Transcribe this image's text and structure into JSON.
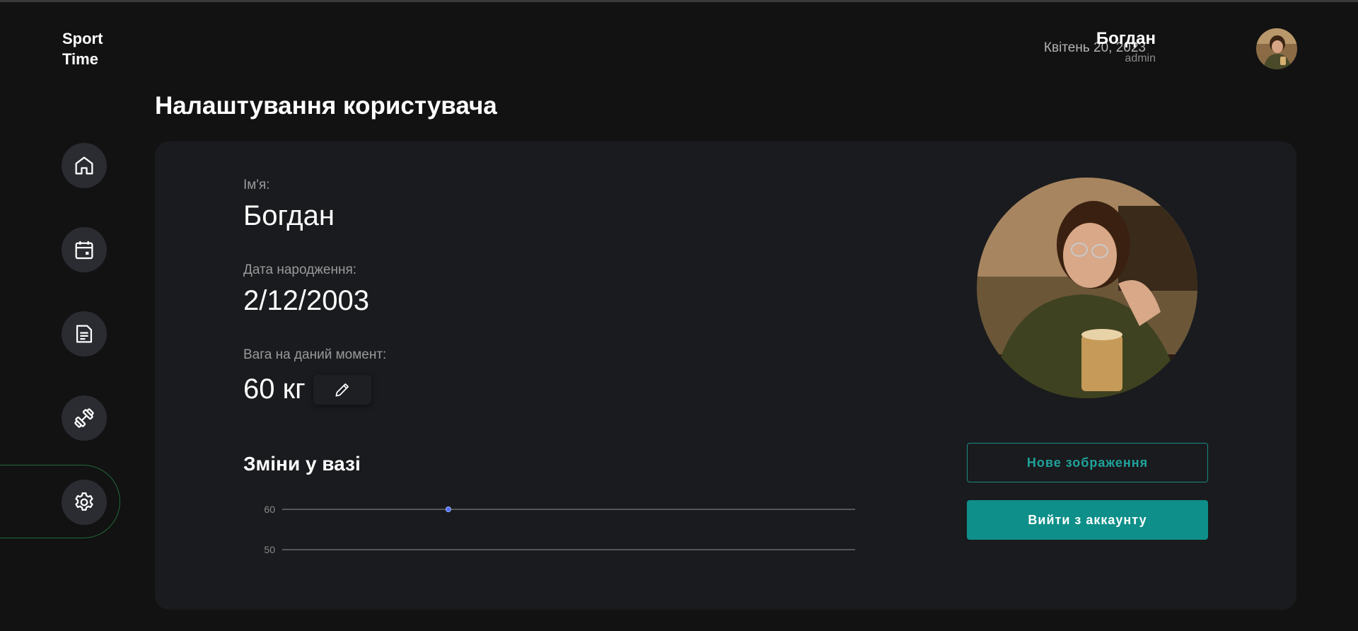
{
  "app": {
    "logo_line1": "Sport",
    "logo_line2": "Time"
  },
  "header": {
    "date": "Квітень 20, 2023",
    "user_name": "Богдан",
    "user_role": "admin"
  },
  "sidebar": {
    "items": [
      {
        "icon": "home-icon"
      },
      {
        "icon": "calendar-icon"
      },
      {
        "icon": "document-icon"
      },
      {
        "icon": "dumbbell-icon"
      },
      {
        "icon": "gear-icon",
        "active": true
      }
    ]
  },
  "page": {
    "title": "Налаштування користувача"
  },
  "profile": {
    "name_label": "Ім'я:",
    "name_value": "Богдан",
    "birth_label": "Дата народження:",
    "birth_value": "2/12/2003",
    "weight_label": "Вага на даний момент:",
    "weight_value": "60 кг",
    "new_image_button": "Нове зображення",
    "logout_button": "Вийти з аккаунту"
  },
  "chart_title": "Зміни у вазі",
  "chart_data": {
    "type": "line",
    "title": "Зміни у вазі",
    "ytick_labels": [
      "60",
      "50"
    ],
    "y_ticks": [
      60,
      50
    ],
    "ylim": [
      50,
      60
    ],
    "series": [
      {
        "points": [
          {
            "x_fraction": 0.29,
            "y": 60
          }
        ]
      }
    ],
    "grid": true
  },
  "colors": {
    "background": "#121212",
    "card": "#1a1b1e",
    "accent": "#0e8f89",
    "accent_text": "#1fa39b",
    "active_ring": "#1f6b3a",
    "point": "#4f6fff"
  }
}
